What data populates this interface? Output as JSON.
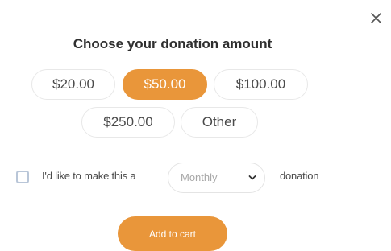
{
  "dialog": {
    "close_icon": "close-icon",
    "title": "Choose your donation amount"
  },
  "amounts": [
    {
      "label": "$20.00",
      "selected": false
    },
    {
      "label": "$50.00",
      "selected": true
    },
    {
      "label": "$100.00",
      "selected": false
    },
    {
      "label": "$250.00",
      "selected": false
    },
    {
      "label": "Other",
      "selected": false
    }
  ],
  "recurring": {
    "checked": false,
    "prefix": "I'd like to make this a",
    "frequency_value": "Monthly",
    "suffix": "donation"
  },
  "add_to_cart_label": "Add to cart",
  "colors": {
    "accent": "#e9963a",
    "checkbox_border": "#b9c6d8"
  }
}
